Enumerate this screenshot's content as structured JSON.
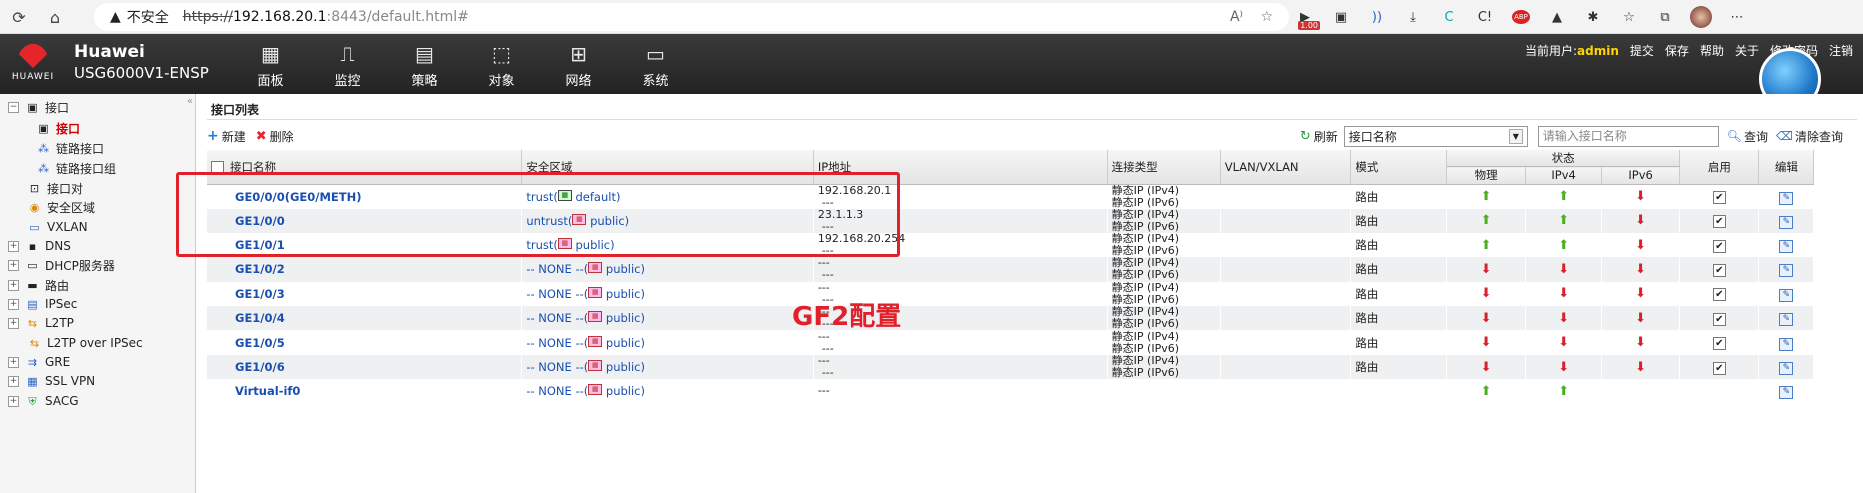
{
  "browser": {
    "insecure_label": "不安全",
    "url_scheme": "https://",
    "url_host": "192.168.20.1",
    "url_rest": ":8443/default.html#",
    "ext_badge": "1.00",
    "ext_abp": "ABP"
  },
  "app": {
    "brand_name": "Huawei",
    "model": "USG6000V1-ENSP",
    "logo_text": "HUAWEI",
    "nav": [
      {
        "label": "面板",
        "icon": "dashboard-icon"
      },
      {
        "label": "监控",
        "icon": "monitor-icon"
      },
      {
        "label": "策略",
        "icon": "policy-icon"
      },
      {
        "label": "对象",
        "icon": "object-icon"
      },
      {
        "label": "网络",
        "icon": "network-icon"
      },
      {
        "label": "系统",
        "icon": "system-icon"
      }
    ],
    "user_label": "当前用户:",
    "user_name": "admin",
    "actions": [
      "提交",
      "保存",
      "帮助",
      "关于",
      "修改密码",
      "注销"
    ]
  },
  "sidebar": {
    "items": [
      {
        "label": "接口",
        "expand": "−",
        "level": 0
      },
      {
        "label": "接口",
        "level": 1,
        "active": true
      },
      {
        "label": "链路接口",
        "level": 1
      },
      {
        "label": "链路接口组",
        "level": 1
      },
      {
        "label": "接口对",
        "level": 0
      },
      {
        "label": "安全区域",
        "level": 0
      },
      {
        "label": "VXLAN",
        "level": 0
      },
      {
        "label": "DNS",
        "expand": "+",
        "level": 0
      },
      {
        "label": "DHCP服务器",
        "expand": "+",
        "level": 0
      },
      {
        "label": "路由",
        "expand": "+",
        "level": 0
      },
      {
        "label": "IPSec",
        "expand": "+",
        "level": 0
      },
      {
        "label": "L2TP",
        "expand": "+",
        "level": 0
      },
      {
        "label": "L2TP over IPSec",
        "level": 0
      },
      {
        "label": "GRE",
        "expand": "+",
        "level": 0
      },
      {
        "label": "SSL VPN",
        "expand": "+",
        "level": 0
      },
      {
        "label": "SACG",
        "expand": "+",
        "level": 0
      }
    ]
  },
  "main": {
    "title": "接口列表",
    "toolbar": {
      "new_label": "新建",
      "delete_label": "删除",
      "refresh_label": "刷新",
      "filter_select": "接口名称",
      "search_placeholder": "请输入接口名称",
      "query_label": "查询",
      "clear_label": "清除查询"
    },
    "columns": {
      "name": "接口名称",
      "zone": "安全区域",
      "ip": "IP地址",
      "conn": "连接类型",
      "vlan": "VLAN/VXLAN",
      "mode": "模式",
      "status": "状态",
      "phys": "物理",
      "ipv4": "IPv4",
      "ipv6": "IPv6",
      "enable": "启用",
      "edit": "编辑"
    },
    "rows": [
      {
        "name": "GE0/0/0(GE0/METH)",
        "zone": "trust(",
        "vsys": "default)",
        "zone_icon": "default",
        "ip1": "192.168.20.1",
        "ip2": "---",
        "conn1": "静态IP (IPv4)",
        "conn2": "静态IP (IPv6)",
        "mode": "路由",
        "phys": "up",
        "ipv4": "up",
        "ipv6": "down",
        "enabled": true
      },
      {
        "name": "GE1/0/0",
        "zone": "untrust(",
        "vsys": "public)",
        "zone_icon": "public",
        "ip1": "23.1.1.3",
        "ip2": "---",
        "conn1": "静态IP (IPv4)",
        "conn2": "静态IP (IPv6)",
        "mode": "路由",
        "phys": "up",
        "ipv4": "up",
        "ipv6": "down",
        "enabled": true
      },
      {
        "name": "GE1/0/1",
        "zone": "trust(",
        "vsys": "public)",
        "zone_icon": "public",
        "ip1": "192.168.20.254",
        "ip2": "---",
        "conn1": "静态IP (IPv4)",
        "conn2": "静态IP (IPv6)",
        "mode": "路由",
        "phys": "up",
        "ipv4": "up",
        "ipv6": "down",
        "enabled": true
      },
      {
        "name": "GE1/0/2",
        "zone": "-- NONE --(",
        "vsys": "public)",
        "zone_icon": "public",
        "ip1": "---",
        "ip2": "---",
        "conn1": "静态IP (IPv4)",
        "conn2": "静态IP (IPv6)",
        "mode": "路由",
        "phys": "down",
        "ipv4": "down",
        "ipv6": "down",
        "enabled": true
      },
      {
        "name": "GE1/0/3",
        "zone": "-- NONE --(",
        "vsys": "public)",
        "zone_icon": "public",
        "ip1": "---",
        "ip2": "---",
        "conn1": "静态IP (IPv4)",
        "conn2": "静态IP (IPv6)",
        "mode": "路由",
        "phys": "down",
        "ipv4": "down",
        "ipv6": "down",
        "enabled": true
      },
      {
        "name": "GE1/0/4",
        "zone": "-- NONE --(",
        "vsys": "public)",
        "zone_icon": "public",
        "ip1": "---",
        "ip2": "---",
        "conn1": "静态IP (IPv4)",
        "conn2": "静态IP (IPv6)",
        "mode": "路由",
        "phys": "down",
        "ipv4": "down",
        "ipv6": "down",
        "enabled": true
      },
      {
        "name": "GE1/0/5",
        "zone": "-- NONE --(",
        "vsys": "public)",
        "zone_icon": "public",
        "ip1": "---",
        "ip2": "---",
        "conn1": "静态IP (IPv4)",
        "conn2": "静态IP (IPv6)",
        "mode": "路由",
        "phys": "down",
        "ipv4": "down",
        "ipv6": "down",
        "enabled": true
      },
      {
        "name": "GE1/0/6",
        "zone": "-- NONE --(",
        "vsys": "public)",
        "zone_icon": "public",
        "ip1": "---",
        "ip2": "---",
        "conn1": "静态IP (IPv4)",
        "conn2": "静态IP (IPv6)",
        "mode": "路由",
        "phys": "down",
        "ipv4": "down",
        "ipv6": "down",
        "enabled": true
      },
      {
        "name": "Virtual-if0",
        "zone": "-- NONE --(",
        "vsys": "public)",
        "zone_icon": "public",
        "ip1": "---",
        "ip2": "",
        "conn1": "",
        "conn2": "",
        "mode": "",
        "phys": "up",
        "ipv4": "up",
        "ipv6": "",
        "enabled": false
      }
    ]
  },
  "annotation": {
    "text": "GF2配置",
    "color": "#e0202a"
  },
  "colors": {
    "header_bg": "#2b2b2b",
    "link_blue": "#1a4fb0",
    "status_up": "#4caf1e",
    "status_down": "#d8222a",
    "active_red": "#d10000"
  }
}
